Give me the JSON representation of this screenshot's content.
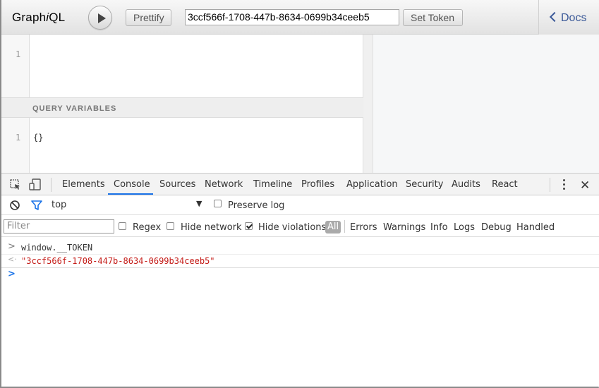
{
  "graphiql": {
    "logo_pre": "Graph",
    "logo_i": "i",
    "logo_post": "QL",
    "prettify_label": "Prettify",
    "token_value": "3ccf566f-1708-447b-8634-0699b34ceeb5",
    "set_token_label": "Set Token",
    "docs_label": "Docs",
    "query_line_number": "1",
    "query_variables_label": "QUERY VARIABLES",
    "vars_line_number": "1",
    "vars_value": "{}"
  },
  "devtools": {
    "tabs": [
      "Elements",
      "Console",
      "Sources",
      "Network",
      "Timeline",
      "Profiles",
      "Application",
      "Security",
      "Audits",
      "React"
    ],
    "active_tab": "Console",
    "context_label": "top",
    "preserve_log_label": "Preserve log",
    "filter_placeholder": "Filter",
    "regex_label": "Regex",
    "hide_network_label": "Hide network",
    "hide_violations_label": "Hide violations",
    "hide_violations_checked": true,
    "levels": [
      "All",
      "Errors",
      "Warnings",
      "Info",
      "Logs",
      "Debug",
      "Handled"
    ],
    "active_level": "All"
  },
  "console": {
    "input_expr": "window.__TOKEN",
    "result_value": "\"3ccf566f-1708-447b-8634-0699b34ceeb5\"",
    "input_prompt": ">",
    "result_prompt": "<·",
    "active_prompt": ">"
  },
  "colors": {
    "accent": "#1a73e8",
    "string": "#c41a16",
    "docs_link": "#3B5998"
  }
}
